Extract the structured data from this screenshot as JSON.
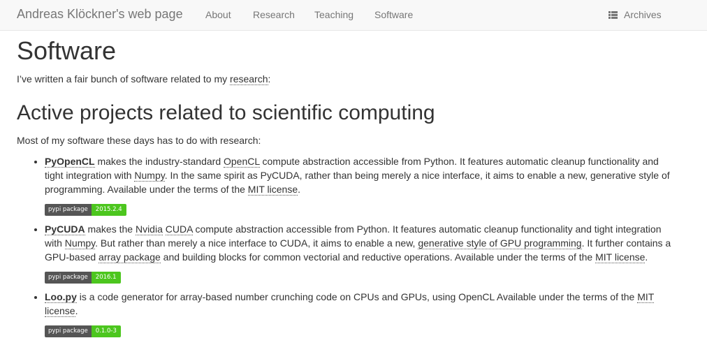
{
  "nav": {
    "brand": "Andreas Klöckner's web page",
    "links": [
      "About",
      "Research",
      "Teaching",
      "Software"
    ],
    "archives": "Archives"
  },
  "page": {
    "title": "Software",
    "intro_before": "I’ve written a fair bunch of software related to my ",
    "intro_link": "research",
    "intro_after": ":",
    "section_title": "Active projects related to scientific computing",
    "section_lead": "Most of my software these days has to do with research:"
  },
  "projects": [
    {
      "name": "PyOpenCL",
      "t1": " makes the industry-standard ",
      "l1": "OpenCL",
      "t2": " compute abstraction accessible from Python. It features automatic cleanup functionality and tight integration with ",
      "l2": "Numpy",
      "t3": ". In the same spirit as PyCUDA, rather than being merely a nice interface, it aims to enable a new, generative style of programming. Available under the terms of the ",
      "l3": "MIT license",
      "t4": ".",
      "badge_label": "pypi package",
      "badge_version": "2015.2.4"
    },
    {
      "name": "PyCUDA",
      "t1": " makes the ",
      "l1": "Nvidia",
      "t1b": " ",
      "l1b": "CUDA",
      "t2": " compute abstraction accessible from Python. It features automatic cleanup functionality and tight integration with ",
      "l2": "Numpy",
      "t3": ". But rather than merely a nice interface to CUDA, it aims to enable a new, ",
      "l3": "generative style of GPU programming",
      "t4": ". It further contains a GPU-based ",
      "l4": "array package",
      "t5": " and building blocks for common vectorial and reductive operations. Available under the terms of the ",
      "l5": "MIT license",
      "t6": ".",
      "badge_label": "pypi package",
      "badge_version": "2016.1"
    },
    {
      "name": "Loo.py",
      "t1": " is a code generator for array-based number crunching code on CPUs and GPUs, using OpenCL Available under the terms of the ",
      "l1": "MIT license",
      "t2": ".",
      "badge_label": "pypi package",
      "badge_version": "0.1.0-3"
    }
  ],
  "colors": {
    "navbar_bg": "#f8f8f8",
    "nav_text": "#777777",
    "badge_left": "#555555",
    "badge_right": "#4cc61e"
  },
  "icons": {
    "archives": "list-icon"
  }
}
